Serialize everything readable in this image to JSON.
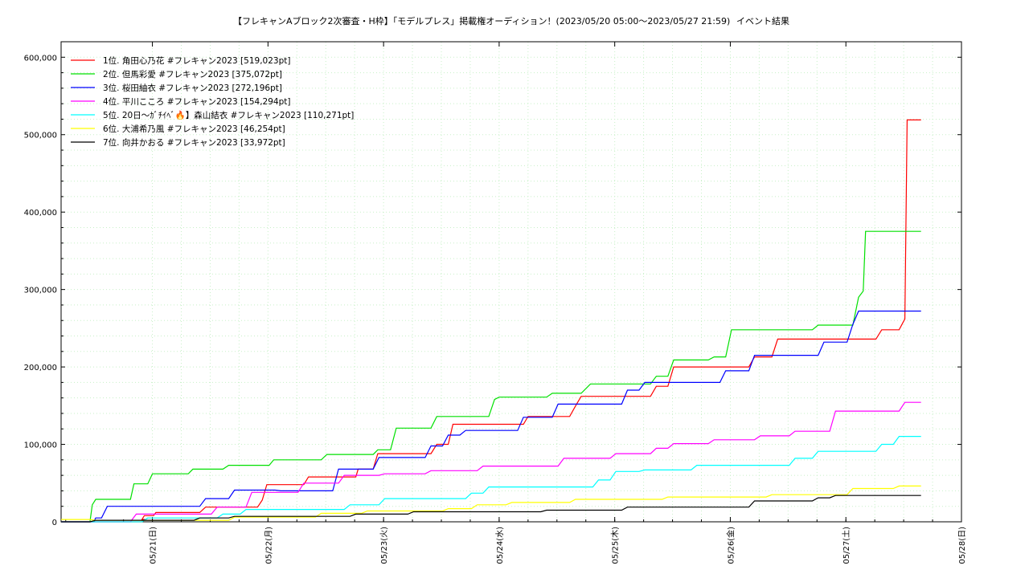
{
  "chart_data": {
    "type": "line",
    "title": "【フレキャンAブロック2次審査・H枠】「モデルプレス」掲載権オーディション！(2023/05/20 05:00〜2023/05/27 21:59)",
    "subtitle": "イベント結果",
    "ylim": [
      0,
      620000
    ],
    "yticks": [
      0,
      100000,
      200000,
      300000,
      400000,
      500000,
      600000
    ],
    "ytick_labels": [
      "0",
      "100,000",
      "200,000",
      "300,000",
      "400,000",
      "500,000",
      "600,000"
    ],
    "xlim": [
      0,
      7.79
    ],
    "xticks": [
      0.79,
      1.79,
      2.79,
      3.79,
      4.79,
      5.79,
      6.79,
      7.79
    ],
    "xtick_labels": [
      "05/21(日)",
      "05/22(月)",
      "05/23(火)",
      "05/24(水)",
      "05/25(木)",
      "05/26(金)",
      "05/27(土)",
      "05/28(日)"
    ],
    "x_unit": "days since 2023/05/20 05:00",
    "grid": true,
    "legend_position": "top-left",
    "series": [
      {
        "name": "1位. 角田心乃花 #フレキャン2023 [519,023pt]",
        "color": "#ff0000",
        "points": [
          [
            0,
            0
          ],
          [
            0.7,
            0
          ],
          [
            0.72,
            3000
          ],
          [
            0.7,
            3000
          ],
          [
            0.72,
            8000
          ],
          [
            0.8,
            8000
          ],
          [
            0.82,
            12000
          ],
          [
            1.2,
            12000
          ],
          [
            1.25,
            19000
          ],
          [
            1.7,
            19000
          ],
          [
            1.74,
            28000
          ],
          [
            1.78,
            48000
          ],
          [
            2.1,
            48000
          ],
          [
            2.14,
            58000
          ],
          [
            2.55,
            58000
          ],
          [
            2.57,
            68000
          ],
          [
            2.7,
            68000
          ],
          [
            2.74,
            88000
          ],
          [
            3.2,
            88000
          ],
          [
            3.25,
            100000
          ],
          [
            3.35,
            100000
          ],
          [
            3.39,
            126000
          ],
          [
            4.0,
            126000
          ],
          [
            4.04,
            136000
          ],
          [
            4.4,
            136000
          ],
          [
            4.46,
            152000
          ],
          [
            4.5,
            162000
          ],
          [
            5.1,
            162000
          ],
          [
            5.15,
            175000
          ],
          [
            5.25,
            175000
          ],
          [
            5.3,
            200000
          ],
          [
            5.95,
            200000
          ],
          [
            6.0,
            213000
          ],
          [
            6.15,
            213000
          ],
          [
            6.2,
            236000
          ],
          [
            7.05,
            236000
          ],
          [
            7.1,
            248000
          ],
          [
            7.25,
            248000
          ],
          [
            7.3,
            262000
          ],
          [
            7.32,
            519023
          ],
          [
            7.44,
            519023
          ]
        ]
      },
      {
        "name": "2位. 但馬彩愛 #フレキャン2023 [375,072pt]",
        "color": "#00e000",
        "points": [
          [
            0,
            0
          ],
          [
            0.25,
            0
          ],
          [
            0.27,
            22000
          ],
          [
            0.3,
            29000
          ],
          [
            0.6,
            29000
          ],
          [
            0.63,
            49000
          ],
          [
            0.75,
            49000
          ],
          [
            0.79,
            62000
          ],
          [
            1.1,
            62000
          ],
          [
            1.14,
            68000
          ],
          [
            1.4,
            68000
          ],
          [
            1.45,
            73000
          ],
          [
            1.8,
            73000
          ],
          [
            1.84,
            80000
          ],
          [
            2.25,
            80000
          ],
          [
            2.3,
            87000
          ],
          [
            2.7,
            87000
          ],
          [
            2.74,
            93000
          ],
          [
            2.85,
            93000
          ],
          [
            2.9,
            121000
          ],
          [
            3.2,
            121000
          ],
          [
            3.25,
            136000
          ],
          [
            3.7,
            136000
          ],
          [
            3.75,
            158000
          ],
          [
            3.79,
            161000
          ],
          [
            4.2,
            161000
          ],
          [
            4.25,
            166000
          ],
          [
            4.5,
            166000
          ],
          [
            4.58,
            178000
          ],
          [
            5.1,
            178000
          ],
          [
            5.15,
            188000
          ],
          [
            5.25,
            188000
          ],
          [
            5.3,
            209000
          ],
          [
            5.6,
            209000
          ],
          [
            5.65,
            213000
          ],
          [
            5.75,
            213000
          ],
          [
            5.8,
            248000
          ],
          [
            6.5,
            248000
          ],
          [
            6.55,
            254000
          ],
          [
            6.85,
            254000
          ],
          [
            6.9,
            290000
          ],
          [
            6.94,
            298000
          ],
          [
            6.96,
            375072
          ],
          [
            7.44,
            375072
          ]
        ]
      },
      {
        "name": "3位. 桜田紬衣 #フレキャン2023 [272,196pt]",
        "color": "#0000ff",
        "points": [
          [
            0,
            0
          ],
          [
            0.28,
            0
          ],
          [
            0.3,
            5000
          ],
          [
            0.35,
            5000
          ],
          [
            0.4,
            20000
          ],
          [
            1.2,
            20000
          ],
          [
            1.25,
            30000
          ],
          [
            1.45,
            30000
          ],
          [
            1.5,
            41000
          ],
          [
            1.85,
            41000
          ],
          [
            1.9,
            40000
          ],
          [
            2.35,
            40000
          ],
          [
            2.4,
            68000
          ],
          [
            2.7,
            68000
          ],
          [
            2.75,
            83000
          ],
          [
            3.15,
            83000
          ],
          [
            3.2,
            98000
          ],
          [
            3.3,
            98000
          ],
          [
            3.35,
            112000
          ],
          [
            3.45,
            112000
          ],
          [
            3.5,
            118000
          ],
          [
            3.95,
            118000
          ],
          [
            4.0,
            135000
          ],
          [
            4.25,
            135000
          ],
          [
            4.3,
            152000
          ],
          [
            4.85,
            152000
          ],
          [
            4.9,
            170000
          ],
          [
            5.0,
            170000
          ],
          [
            5.05,
            180000
          ],
          [
            5.7,
            180000
          ],
          [
            5.75,
            195000
          ],
          [
            5.95,
            195000
          ],
          [
            6.0,
            215000
          ],
          [
            6.55,
            215000
          ],
          [
            6.6,
            232000
          ],
          [
            6.8,
            232000
          ],
          [
            6.85,
            255000
          ],
          [
            6.9,
            272196
          ],
          [
            7.44,
            272196
          ]
        ]
      },
      {
        "name": "4位. 平川こころ #フレキャン2023 [154,294pt]",
        "color": "#ff00ff",
        "points": [
          [
            0,
            0
          ],
          [
            0.6,
            0
          ],
          [
            0.65,
            10000
          ],
          [
            1.3,
            10000
          ],
          [
            1.35,
            19000
          ],
          [
            1.6,
            19000
          ],
          [
            1.65,
            38000
          ],
          [
            2.05,
            38000
          ],
          [
            2.1,
            50000
          ],
          [
            2.4,
            50000
          ],
          [
            2.45,
            60000
          ],
          [
            2.75,
            60000
          ],
          [
            2.8,
            62000
          ],
          [
            3.15,
            62000
          ],
          [
            3.2,
            66000
          ],
          [
            3.6,
            66000
          ],
          [
            3.65,
            72000
          ],
          [
            4.3,
            72000
          ],
          [
            4.35,
            82000
          ],
          [
            4.75,
            82000
          ],
          [
            4.8,
            88000
          ],
          [
            5.1,
            88000
          ],
          [
            5.15,
            95000
          ],
          [
            5.25,
            95000
          ],
          [
            5.3,
            101000
          ],
          [
            5.6,
            101000
          ],
          [
            5.65,
            106000
          ],
          [
            6.0,
            106000
          ],
          [
            6.05,
            111000
          ],
          [
            6.3,
            111000
          ],
          [
            6.35,
            117000
          ],
          [
            6.65,
            117000
          ],
          [
            6.7,
            143000
          ],
          [
            7.25,
            143000
          ],
          [
            7.3,
            154294
          ],
          [
            7.44,
            154294
          ]
        ]
      },
      {
        "name": "5位. 20日〜ｶﾞﾁｲﾍﾞ🔥】森山結衣 #フレキャン2023 [110,271pt]",
        "color": "#00ffff",
        "points": [
          [
            0,
            0
          ],
          [
            0.7,
            0
          ],
          [
            0.75,
            5000
          ],
          [
            1.35,
            5000
          ],
          [
            1.4,
            10000
          ],
          [
            1.55,
            10000
          ],
          [
            1.6,
            16000
          ],
          [
            2.45,
            16000
          ],
          [
            2.5,
            22000
          ],
          [
            2.75,
            22000
          ],
          [
            2.8,
            30000
          ],
          [
            3.5,
            30000
          ],
          [
            3.55,
            37000
          ],
          [
            3.65,
            37000
          ],
          [
            3.7,
            45000
          ],
          [
            4.6,
            45000
          ],
          [
            4.65,
            54000
          ],
          [
            4.75,
            54000
          ],
          [
            4.8,
            65000
          ],
          [
            5.0,
            65000
          ],
          [
            5.05,
            67000
          ],
          [
            5.45,
            67000
          ],
          [
            5.5,
            73000
          ],
          [
            6.3,
            73000
          ],
          [
            6.35,
            82000
          ],
          [
            6.5,
            82000
          ],
          [
            6.55,
            91000
          ],
          [
            7.05,
            91000
          ],
          [
            7.1,
            100000
          ],
          [
            7.2,
            100000
          ],
          [
            7.25,
            110271
          ],
          [
            7.44,
            110271
          ]
        ]
      },
      {
        "name": "6位. 大浦希乃風 #フレキャン2023 [46,254pt]",
        "color": "#ffff00",
        "points": [
          [
            0,
            3000
          ],
          [
            0.25,
            3000
          ],
          [
            0.3,
            2000
          ],
          [
            1.45,
            2000
          ],
          [
            1.5,
            6000
          ],
          [
            2.2,
            6000
          ],
          [
            2.25,
            11000
          ],
          [
            2.6,
            11000
          ],
          [
            2.65,
            14000
          ],
          [
            3.3,
            14000
          ],
          [
            3.35,
            17000
          ],
          [
            3.55,
            17000
          ],
          [
            3.6,
            22000
          ],
          [
            3.85,
            22000
          ],
          [
            3.9,
            25000
          ],
          [
            4.4,
            25000
          ],
          [
            4.45,
            29000
          ],
          [
            5.2,
            29000
          ],
          [
            5.25,
            32000
          ],
          [
            6.1,
            32000
          ],
          [
            6.15,
            35000
          ],
          [
            6.8,
            35000
          ],
          [
            6.85,
            43000
          ],
          [
            7.2,
            43000
          ],
          [
            7.25,
            46254
          ],
          [
            7.44,
            46254
          ]
        ]
      },
      {
        "name": "7位. 向井かおる #フレキャン2023 [33,972pt]",
        "color": "#000000",
        "points": [
          [
            0,
            0
          ],
          [
            0.25,
            0
          ],
          [
            0.3,
            2000
          ],
          [
            1.15,
            2000
          ],
          [
            1.2,
            5000
          ],
          [
            1.45,
            5000
          ],
          [
            1.5,
            7000
          ],
          [
            2.5,
            7000
          ],
          [
            2.55,
            10000
          ],
          [
            3.0,
            10000
          ],
          [
            3.05,
            13000
          ],
          [
            4.15,
            13000
          ],
          [
            4.2,
            15000
          ],
          [
            4.85,
            15000
          ],
          [
            4.9,
            19000
          ],
          [
            5.95,
            19000
          ],
          [
            6.0,
            27000
          ],
          [
            6.5,
            27000
          ],
          [
            6.55,
            31000
          ],
          [
            6.65,
            31000
          ],
          [
            6.7,
            34000
          ],
          [
            7.44,
            33972
          ]
        ]
      }
    ]
  }
}
